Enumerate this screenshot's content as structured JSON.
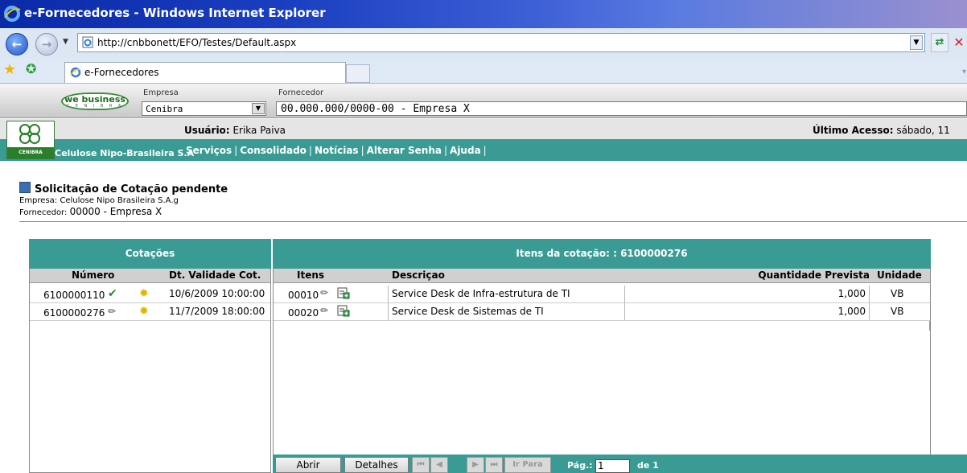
{
  "window": {
    "title": "e-Fornecedores - Windows Internet Explorer"
  },
  "browser": {
    "url": "http://cnbbonett/EFO/Testes/Default.aspx",
    "tab_title": "e-Fornecedores"
  },
  "app_header": {
    "logo_top": "we business",
    "logo_bottom": "C E N I B R A",
    "empresa_label": "Empresa",
    "empresa_value": "Cenibra",
    "fornecedor_label": "Fornecedor",
    "fornecedor_value": "00.000.000/0000-00 - Empresa X"
  },
  "brand": {
    "company": "Celulose Nipo-Brasileira S.A",
    "logo_text": "CENIBRA"
  },
  "user_bar": {
    "usuario_label": "Usuário:",
    "usuario_value": "Erika Paiva",
    "ultimo_label": "Último Acesso:",
    "ultimo_value": "sábado, 11"
  },
  "menu": [
    "Serviços",
    "Consolidado",
    "Notícias",
    "Alterar Senha",
    "Ajuda"
  ],
  "section": {
    "title": "Solicitação de Cotação pendente",
    "empresa_line": "Empresa: Celulose Nipo Brasileira S.A.g",
    "fornecedor_label": "Fornecedor:",
    "fornecedor_value": "00000 - Empresa X"
  },
  "cotacoes": {
    "title": "Cotações",
    "columns": {
      "numero": "Número",
      "validade": "Dt. Validade Cot."
    },
    "rows": [
      {
        "numero": "6100000110",
        "status_icon": "check-icon",
        "validade": "10/6/2009 10:00:00"
      },
      {
        "numero": "6100000276",
        "status_icon": "pencil-icon",
        "validade": "11/7/2009 18:00:00"
      }
    ]
  },
  "itens": {
    "title": "Itens da cotação: : 6100000276",
    "columns": {
      "itens": "Itens",
      "descricao": "Descriçao",
      "quantidade": "Quantidade Prevista",
      "unidade": "Unidade"
    },
    "rows": [
      {
        "item": "00010",
        "descricao": "Service Desk de Infra-estrutura de TI",
        "quantidade": "1,000",
        "unidade": "VB"
      },
      {
        "item": "00020",
        "descricao": "Service Desk de Sistemas de TI",
        "quantidade": "1,000",
        "unidade": "VB"
      }
    ]
  },
  "toolbar": {
    "abrir": "Abrir",
    "detalhes": "Detalhes",
    "first": "⏮",
    "prev": "◀",
    "next": "▶",
    "last": "⏭",
    "ir_para": "Ir Para",
    "pag_label": "Pág.:",
    "pag_value": "1",
    "de_label": "de 1"
  },
  "colors": {
    "accent": "#3a9b95",
    "title_bar": "#0a2aa8"
  }
}
